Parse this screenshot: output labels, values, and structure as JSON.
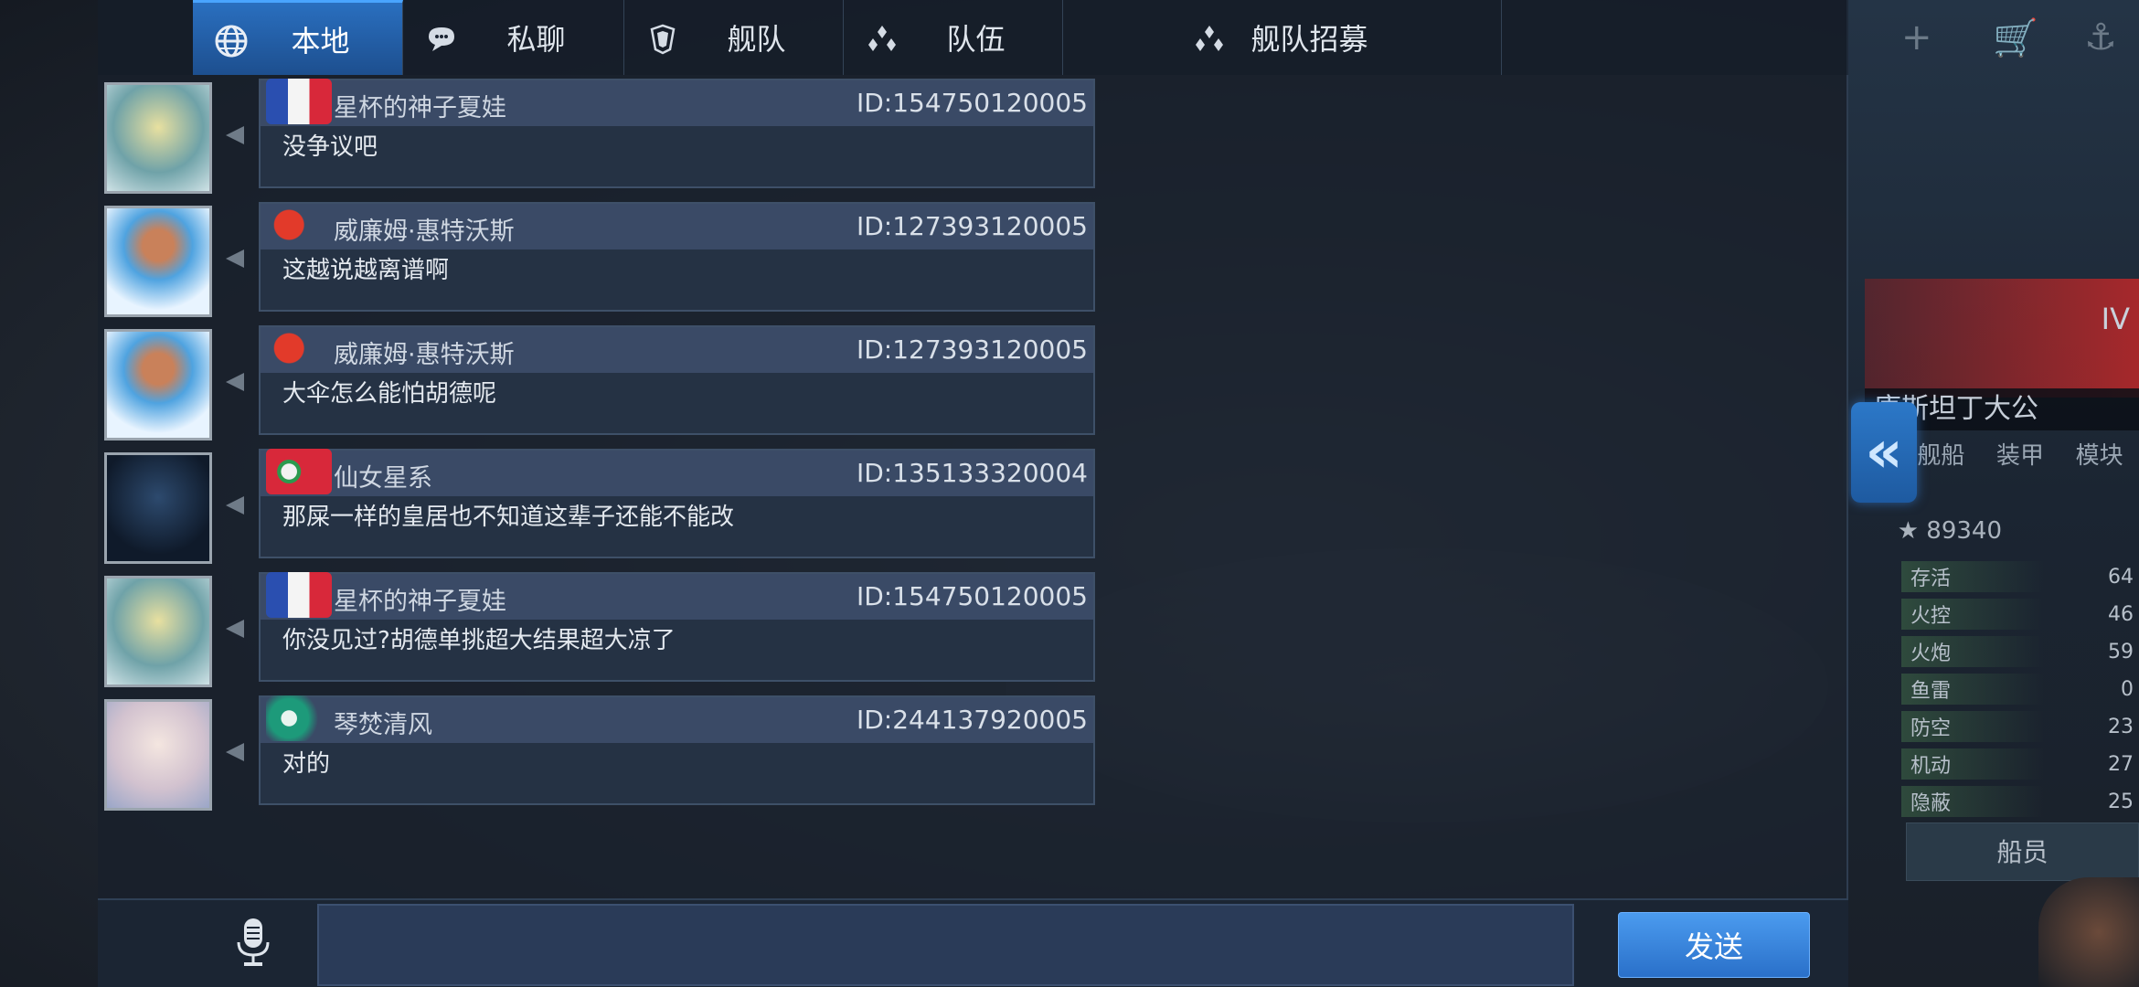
{
  "tabs": [
    {
      "label": "本地",
      "icon": "globe-icon",
      "active": true
    },
    {
      "label": "私聊",
      "icon": "chat-bubble-icon",
      "active": false
    },
    {
      "label": "舰队",
      "icon": "fleet-icon",
      "active": false
    },
    {
      "label": "队伍",
      "icon": "team-icon",
      "active": false
    },
    {
      "label": "舰队招募",
      "icon": "recruit-icon",
      "active": false
    }
  ],
  "messages": [
    {
      "name": "星杯的神子夏娃",
      "uid": "ID:154750120005",
      "text": "没争议吧",
      "flag": "french-flag"
    },
    {
      "name": "威廉姆·惠特沃斯",
      "uid": "ID:127393120005",
      "text": "这越说越离谱啊",
      "flag": "lantern-flag"
    },
    {
      "name": "威廉姆·惠特沃斯",
      "uid": "ID:127393120005",
      "text": "大伞怎么能怕胡德呢",
      "flag": "lantern-flag"
    },
    {
      "name": "仙女星系",
      "uid": "ID:135133320004",
      "text": "那屎一样的皇居也不知道这辈子还能不能改",
      "flag": "red-flag"
    },
    {
      "name": "星杯的神子夏娃",
      "uid": "ID:154750120005",
      "text": "你没见过?胡德单挑超大结果超大凉了",
      "flag": "french-flag"
    },
    {
      "name": "琴焚清风",
      "uid": "ID:244137920005",
      "text": "对的",
      "flag": "green-flag"
    }
  ],
  "input": {
    "value": "",
    "placeholder": ""
  },
  "send_label": "发送",
  "side_panel": {
    "ship_name": "康斯坦丁大公",
    "tabs": [
      "舰船",
      "装甲",
      "模块"
    ],
    "power": "★ 89340",
    "stats": [
      {
        "label": "存活",
        "value": "64"
      },
      {
        "label": "火控",
        "value": "46"
      },
      {
        "label": "火炮",
        "value": "59"
      },
      {
        "label": "鱼雷",
        "value": "0"
      },
      {
        "label": "防空",
        "value": "23"
      },
      {
        "label": "机动",
        "value": "27"
      },
      {
        "label": "隐蔽",
        "value": "25"
      }
    ],
    "crew_label": "船员",
    "tier": "IV"
  }
}
